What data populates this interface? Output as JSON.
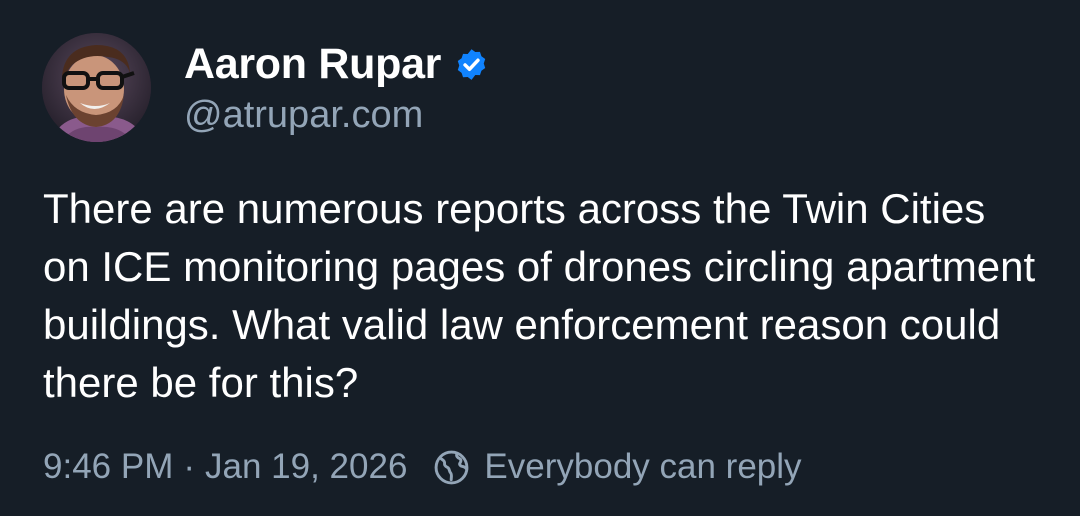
{
  "author": {
    "display_name": "Aaron Rupar",
    "handle": "@atrupar.com",
    "verified_icon": "verified-check-icon",
    "avatar_icon": "profile-photo"
  },
  "post": {
    "text": "There are numerous reports across the Twin Cities on ICE monitoring pages of drones circling apartment buildings. What valid law enforcement reason could there be for this?"
  },
  "meta": {
    "time": "9:46 PM",
    "separator": "·",
    "date": "Jan 19, 2026",
    "reply_icon": "globe-icon",
    "reply_setting": "Everybody can reply"
  },
  "colors": {
    "background": "#161e27",
    "text": "#ffffff",
    "muted": "#93a5b7",
    "verified": "#1083fe"
  }
}
